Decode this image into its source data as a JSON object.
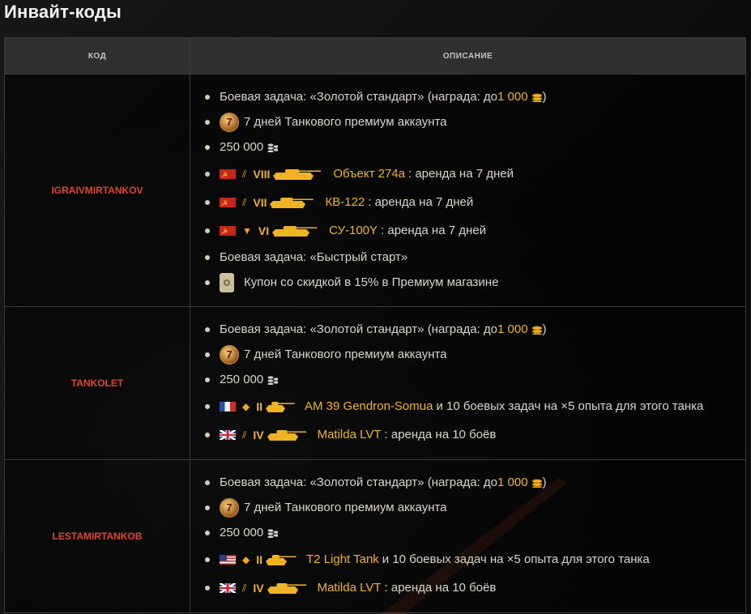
{
  "page_title": "Инвайт-коды",
  "table": {
    "col_code": "КОД",
    "col_desc": "ОПИСАНИЕ"
  },
  "colors": {
    "accent_code": "#e0442a",
    "gold": "#f0b323",
    "background": "#0c0c0c"
  },
  "rows": [
    {
      "code": "IGRAIVMIRTANKOV",
      "items": [
        {
          "kind": "mission",
          "text": "Боевая задача: «Золотой стандарт» (награда: до ",
          "gold": "1 000",
          "tail": ")",
          "icon": "gold-coins-icon"
        },
        {
          "kind": "premium",
          "badge": "7",
          "text": "7 дней Танкового премиум аккаунта",
          "icon": "premium-medal-icon"
        },
        {
          "kind": "credits",
          "text": "250 000",
          "icon": "credits-icon"
        },
        {
          "kind": "tank",
          "flag": "ussr",
          "cls": "medium-tank-icon",
          "tier": "VIII",
          "name": "Объект 274а",
          "tail": " : аренда на 7 дней",
          "icon": "tank-silhouette-icon"
        },
        {
          "kind": "tank",
          "flag": "ussr",
          "cls": "medium-tank-icon",
          "tier": "VII",
          "name": "КВ-122",
          "tail": " : аренда на 7 дней",
          "icon": "tank-silhouette-icon"
        },
        {
          "kind": "tank",
          "flag": "ussr",
          "cls": "tank-destroyer-icon",
          "tier": "VI",
          "name": "СУ-100Y",
          "tail": " : аренда на 7 дней",
          "icon": "tank-silhouette-icon"
        },
        {
          "kind": "text",
          "text": "Боевая задача: «Быстрый старт»"
        },
        {
          "kind": "coupon",
          "text": "Купон со скидкой в 15% в Премиум магазине",
          "icon": "coupon-icon"
        }
      ]
    },
    {
      "code": "TANKOLET",
      "items": [
        {
          "kind": "mission",
          "text": "Боевая задача: «Золотой стандарт» (награда: до ",
          "gold": "1 000",
          "tail": ")",
          "icon": "gold-coins-icon"
        },
        {
          "kind": "premium",
          "badge": "7",
          "text": "7 дней Танкового премиум аккаунта",
          "icon": "premium-medal-icon"
        },
        {
          "kind": "credits",
          "text": "250 000",
          "icon": "credits-icon"
        },
        {
          "kind": "tank",
          "flag": "fr",
          "cls": "light-tank-icon",
          "tier": "II",
          "name": "AM 39 Gendron-Somua",
          "tail": "  и 10 боевых задач на ×5 опыта для этого танка",
          "icon": "tank-silhouette-icon"
        },
        {
          "kind": "tank",
          "flag": "uk",
          "cls": "medium-tank-icon",
          "tier": "IV",
          "name": "Matilda LVT",
          "tail": " : аренда на 10 боёв",
          "icon": "tank-silhouette-icon"
        }
      ]
    },
    {
      "code": "LESTAMIRTANKOB",
      "items": [
        {
          "kind": "mission",
          "text": "Боевая задача: «Золотой стандарт» (награда: до ",
          "gold": "1 000",
          "tail": ")",
          "icon": "gold-coins-icon"
        },
        {
          "kind": "premium",
          "badge": "7",
          "text": "7 дней Танкового премиум аккаунта",
          "icon": "premium-medal-icon"
        },
        {
          "kind": "credits",
          "text": "250 000",
          "icon": "credits-icon"
        },
        {
          "kind": "tank",
          "flag": "usa",
          "cls": "light-tank-icon",
          "tier": "II",
          "name": "T2 Light Tank",
          "tail": "  и 10 боевых задач на ×5 опыта для этого танка",
          "icon": "tank-silhouette-icon"
        },
        {
          "kind": "tank",
          "flag": "uk",
          "cls": "medium-tank-icon",
          "tier": "IV",
          "name": "Matilda LVT",
          "tail": " : аренда на 10 боёв",
          "icon": "tank-silhouette-icon"
        }
      ]
    }
  ]
}
